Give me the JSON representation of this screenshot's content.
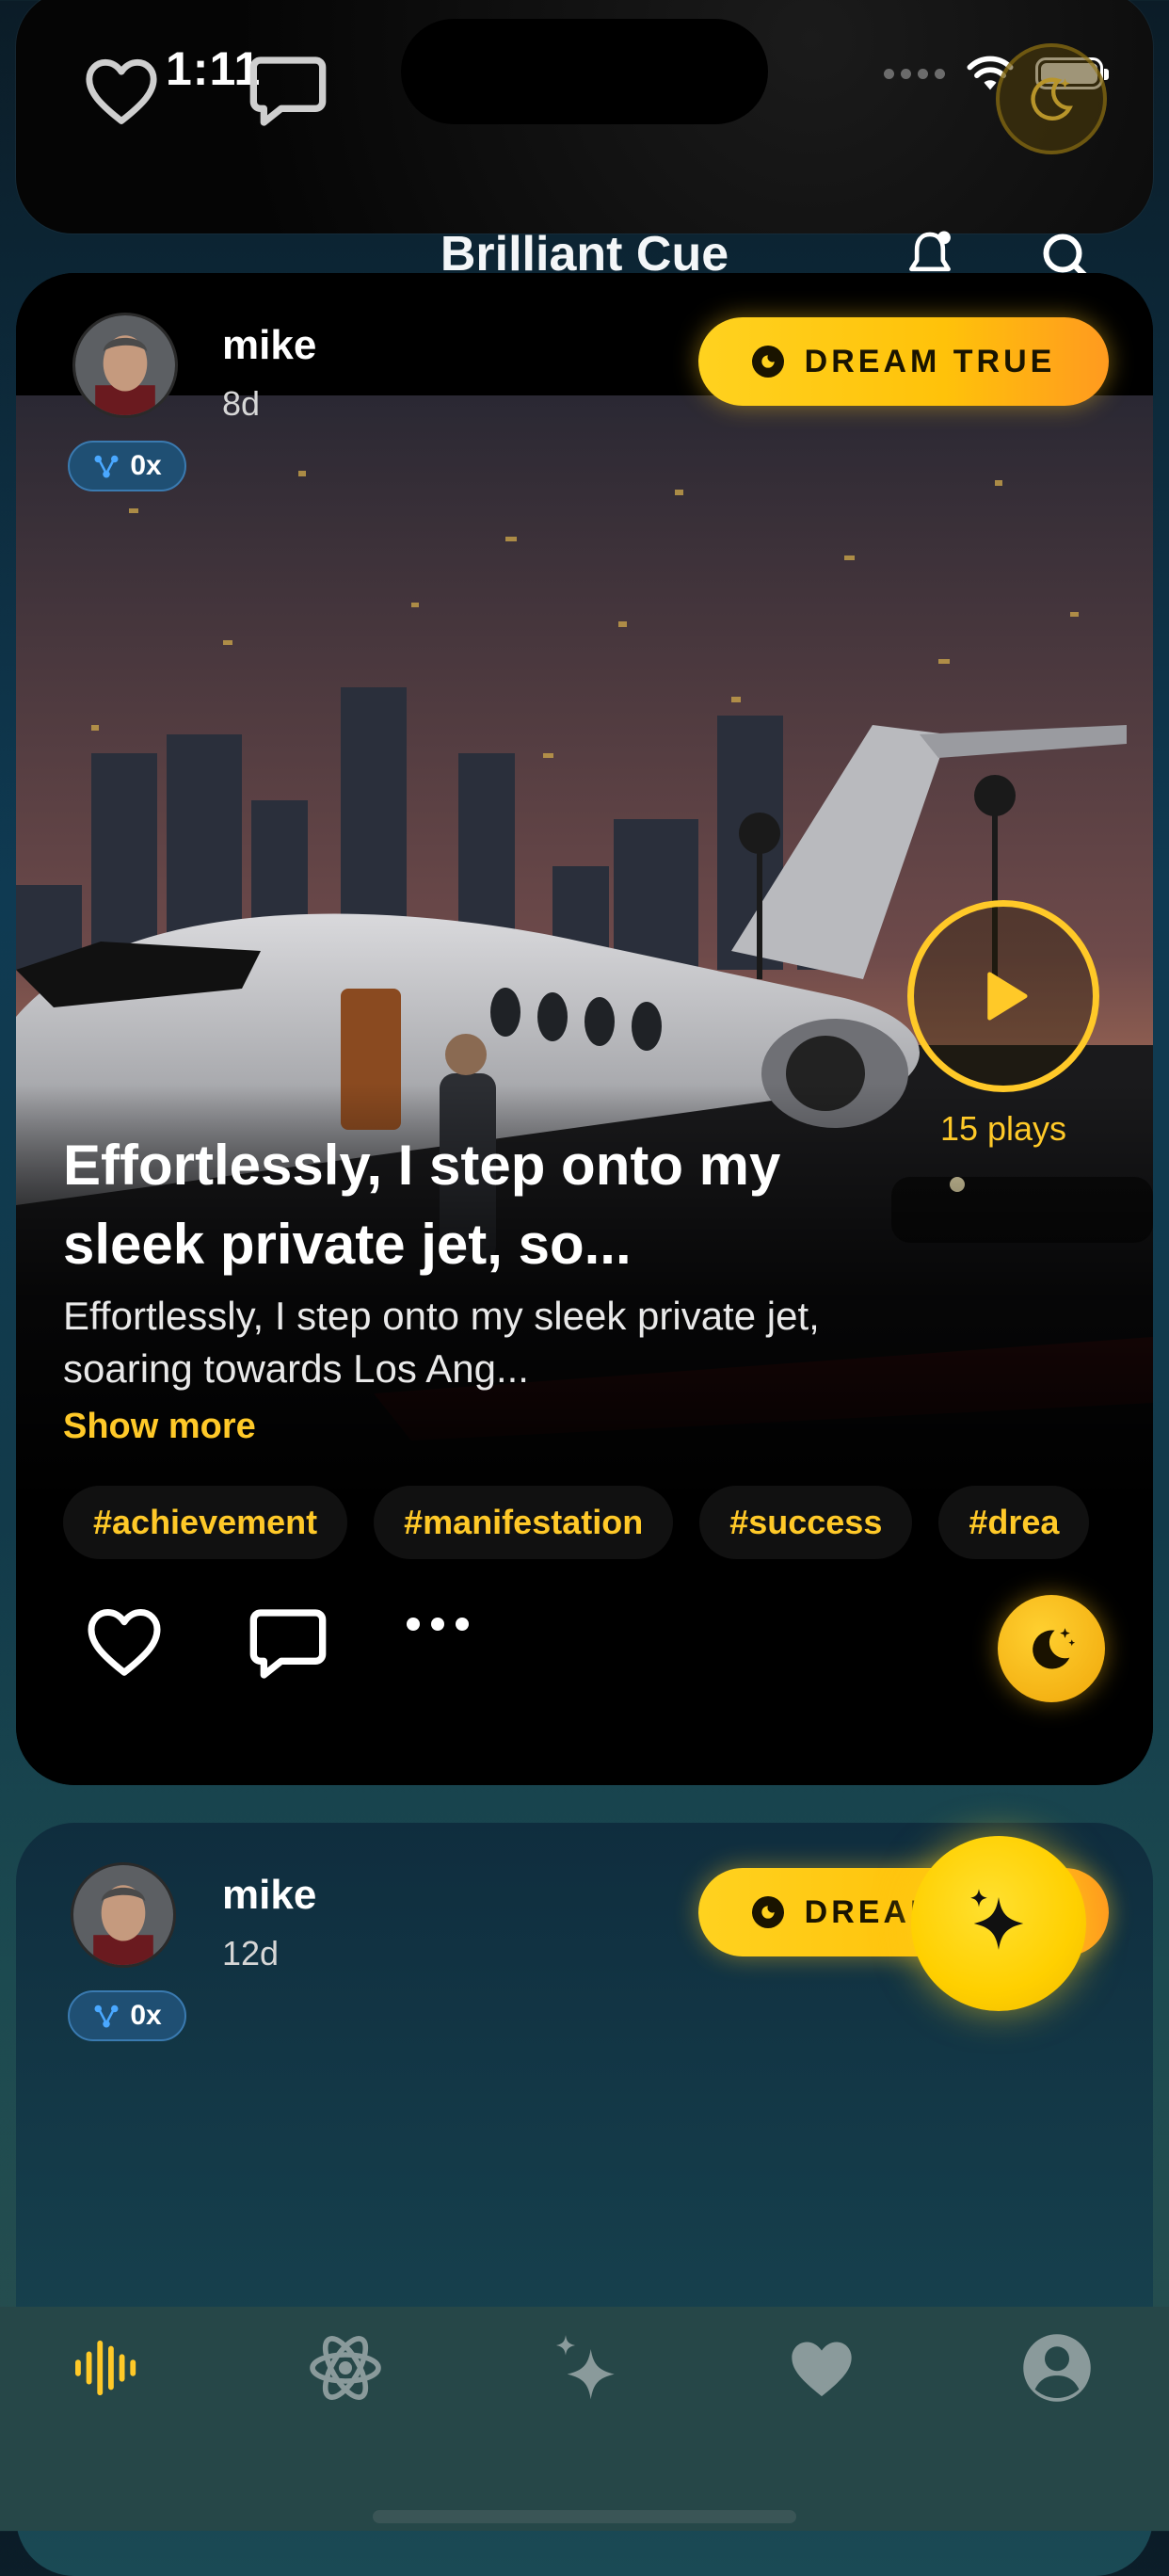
{
  "status_bar": {
    "time": "1:11"
  },
  "header": {
    "title": "Brilliant Cue"
  },
  "posts": [
    {
      "author": "mike",
      "age": "8d",
      "counter": "0x",
      "dream_button": "DREAM TRUE",
      "plays": "15 plays",
      "title": "Effortlessly, I step onto my sleek private jet, so...",
      "excerpt": "Effortlessly, I step onto my sleek private jet, soaring towards Los Ang...",
      "show_more": "Show more",
      "tags": [
        "#achievement",
        "#manifestation",
        "#success",
        "#drea"
      ]
    },
    {
      "author": "mike",
      "age": "12d",
      "counter": "0x",
      "dream_button": "DREAM TRUE"
    }
  ],
  "tabs": [
    {
      "icon": "waveform-icon",
      "active": true
    },
    {
      "icon": "atom-icon",
      "active": false
    },
    {
      "icon": "sparkles-icon",
      "active": false
    },
    {
      "icon": "heart-icon",
      "active": false
    },
    {
      "icon": "profile-icon",
      "active": false
    }
  ],
  "colors": {
    "accent": "#ffc928",
    "card": "#000000",
    "tab_bar": "#264748",
    "badge": "#1f4f73"
  }
}
